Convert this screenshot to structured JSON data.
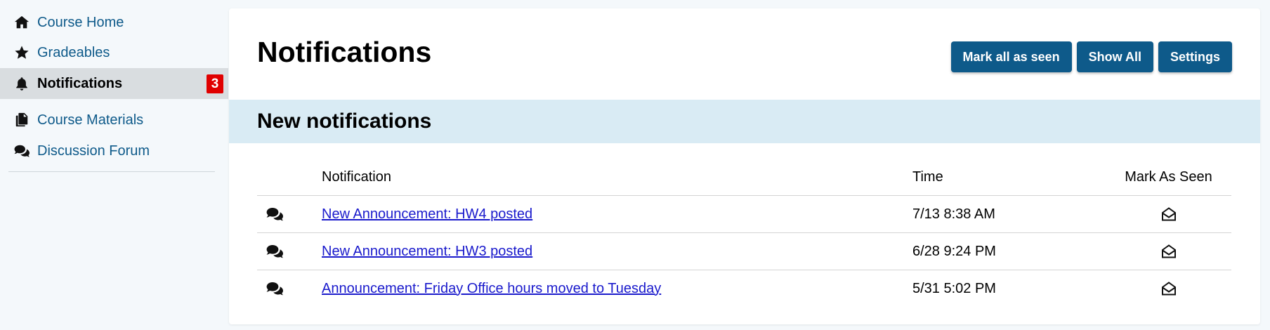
{
  "sidebar": {
    "items": [
      {
        "label": "Course Home",
        "icon": "home-icon"
      },
      {
        "label": "Gradeables",
        "icon": "star-icon"
      },
      {
        "label": "Notifications",
        "icon": "bell-icon",
        "active": true,
        "badge": "3"
      },
      {
        "label": "Course Materials",
        "icon": "files-icon"
      },
      {
        "label": "Discussion Forum",
        "icon": "comments-icon"
      }
    ]
  },
  "main": {
    "title": "Notifications",
    "buttons": {
      "mark_all": "Mark all as seen",
      "show_all": "Show All",
      "settings": "Settings"
    },
    "section_title": "New notifications",
    "table": {
      "headers": {
        "notification": "Notification",
        "time": "Time",
        "mark_as_seen": "Mark As Seen"
      },
      "rows": [
        {
          "icon": "comments-icon",
          "text": "New Announcement: HW4 posted",
          "time": "7/13 8:38 AM",
          "seen_icon": "envelope-open-icon"
        },
        {
          "icon": "comments-icon",
          "text": "New Announcement: HW3 posted",
          "time": "6/28 9:24 PM",
          "seen_icon": "envelope-open-icon"
        },
        {
          "icon": "comments-icon",
          "text": "Announcement: Friday Office hours moved to Tuesday",
          "time": "5/31 5:02 PM",
          "seen_icon": "envelope-open-icon"
        }
      ]
    }
  },
  "colors": {
    "link": "#0e5a8a",
    "button": "#0e5a8a",
    "badge": "#e00000",
    "section_bar": "#d9ebf4",
    "active_nav": "#d9dde0",
    "notification_link": "#1a1acc"
  }
}
